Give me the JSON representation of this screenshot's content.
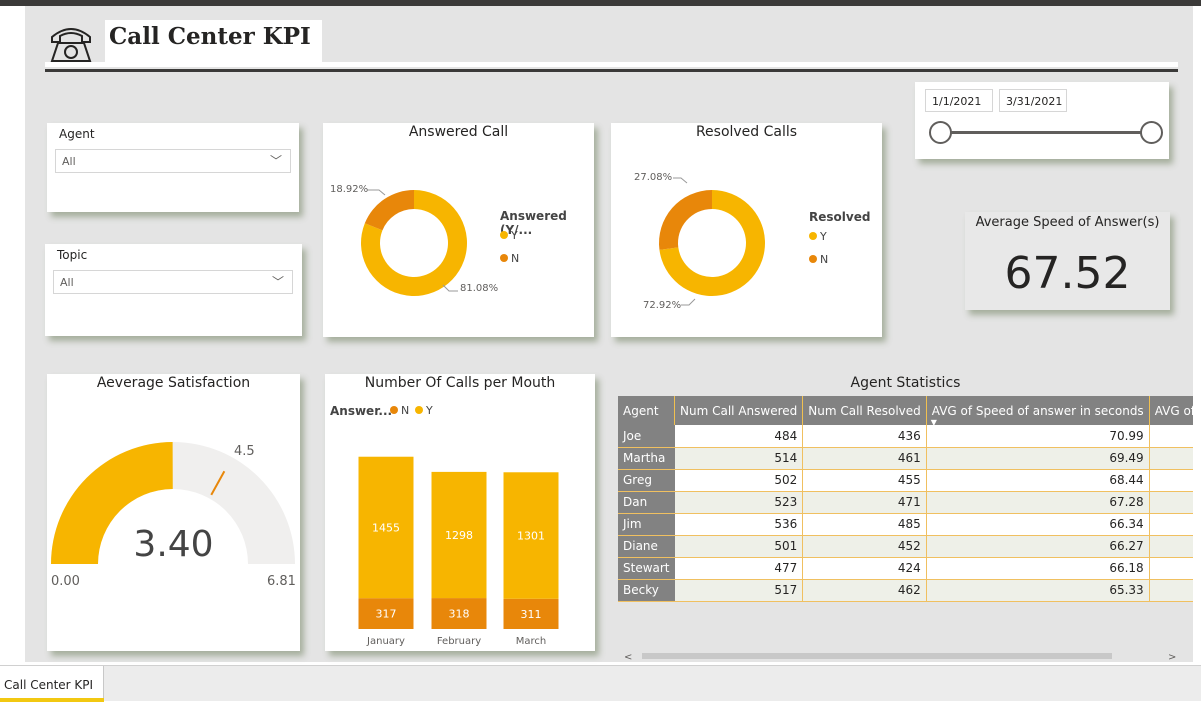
{
  "header": {
    "title": "Call Center KPI",
    "icon": "phone-icon"
  },
  "slicers": {
    "agent": {
      "label": "Agent",
      "value": "All"
    },
    "topic": {
      "label": "Topic",
      "value": "All"
    }
  },
  "date_range": {
    "start": "1/1/2021",
    "end": "3/31/2021"
  },
  "answered_call": {
    "title": "Answered Call",
    "legend_title": "Answered (Y/...",
    "legend": [
      "Y",
      "N"
    ],
    "pct_y": "81.08%",
    "pct_n": "18.92%"
  },
  "resolved_calls": {
    "title": "Resolved Calls",
    "legend_title": "Resolved",
    "legend": [
      "Y",
      "N"
    ],
    "pct_y": "72.92%",
    "pct_n": "27.08%"
  },
  "speed_of_answer": {
    "title": "Average Speed of Answer(s)",
    "value": "67.52"
  },
  "satisfaction": {
    "title": "Aeverage Satisfaction",
    "value": "3.40",
    "min": "0.00",
    "max": "6.81",
    "target": "4.5",
    "fill_fraction": 0.499,
    "target_fraction": 0.661
  },
  "calls_per_month": {
    "title": "Number Of Calls per Mouth",
    "legend_title": "Answer...",
    "legend": [
      "N",
      "Y"
    ]
  },
  "agent_stats": {
    "title": "Agent Statistics",
    "columns": [
      "Agent",
      "Num Call Answered",
      "Num Call Resolved",
      "AVG of Speed of answer in seconds",
      "AVG of Satisfaction"
    ],
    "rows": [
      [
        "Joe",
        "484",
        "436",
        "70.99",
        ""
      ],
      [
        "Martha",
        "514",
        "461",
        "69.49",
        ""
      ],
      [
        "Greg",
        "502",
        "455",
        "68.44",
        ""
      ],
      [
        "Dan",
        "523",
        "471",
        "67.28",
        ""
      ],
      [
        "Jim",
        "536",
        "485",
        "66.34",
        ""
      ],
      [
        "Diane",
        "501",
        "452",
        "66.27",
        ""
      ],
      [
        "Stewart",
        "477",
        "424",
        "66.18",
        ""
      ],
      [
        "Becky",
        "517",
        "462",
        "65.33",
        ""
      ]
    ]
  },
  "footer": {
    "tab_label": "Call Center KPI"
  },
  "colors": {
    "accent": "#f7b500",
    "dark_accent": "#e8870a",
    "track": "#f0efee",
    "header_gray": "#828282"
  },
  "chart_data": [
    {
      "type": "pie",
      "title": "Answered Call",
      "categories": [
        "Y",
        "N"
      ],
      "values": [
        81.08,
        18.92
      ]
    },
    {
      "type": "pie",
      "title": "Resolved Calls",
      "categories": [
        "Y",
        "N"
      ],
      "values": [
        72.92,
        27.08
      ]
    },
    {
      "type": "bar",
      "title": "Number Of Calls per Mouth",
      "categories": [
        "January",
        "February",
        "March"
      ],
      "series": [
        {
          "name": "Y",
          "values": [
            1455,
            1298,
            1301
          ]
        },
        {
          "name": "N",
          "values": [
            317,
            318,
            311
          ]
        }
      ],
      "stacked": true
    }
  ]
}
